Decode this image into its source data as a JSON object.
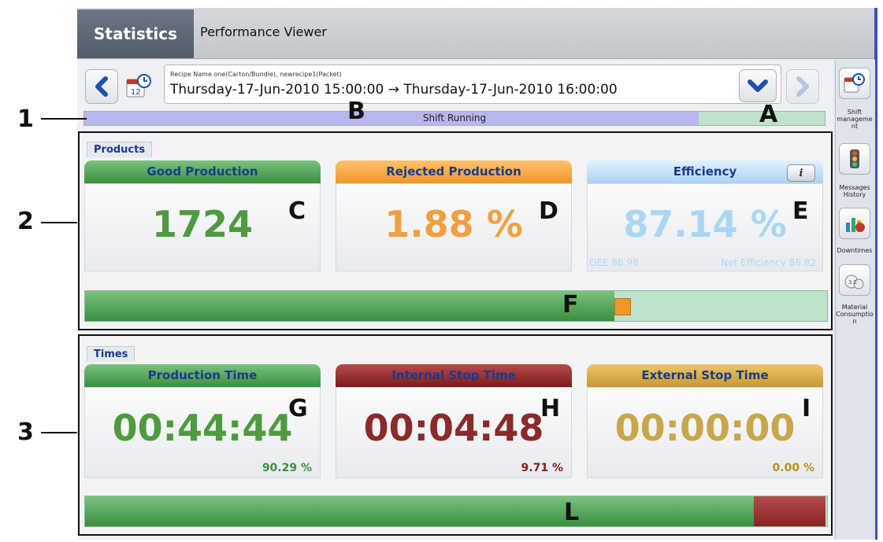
{
  "app": {
    "title": "Statistics",
    "subtitle": "Performance Viewer"
  },
  "nav": {
    "recipe": "Recipe Name   one(Carton/Bundle), newrecipe1(Packet)",
    "date_range": "Thursday-17-Jun-2010 15:00:00  →  Thursday-17-Jun-2010 16:00:00"
  },
  "shift": {
    "status": "Shift Running",
    "progress": 0.83
  },
  "products": {
    "label": "Products",
    "good": {
      "title": "Good Production",
      "value": "1724"
    },
    "rejected": {
      "title": "Rejected Production",
      "value": "1.88 %"
    },
    "efficiency": {
      "title": "Efficiency",
      "value": "87.14 %",
      "oee": "OEE 86.98",
      "net": "Net Efficiency 86.82"
    },
    "bar": {
      "good_fraction": 0.715,
      "rejected_fraction": 0.02
    }
  },
  "times": {
    "label": "Times",
    "production": {
      "title": "Production Time",
      "value": "00:44:44",
      "pct": "90.29 %"
    },
    "internal": {
      "title": "Internal Stop Time",
      "value": "00:04:48",
      "pct": "9.71 %"
    },
    "external": {
      "title": "External Stop Time",
      "value": "00:00:00",
      "pct": "0.00 %"
    },
    "bar": {
      "production_fraction": 0.9029,
      "internal_fraction": 0.0971
    }
  },
  "sidebar": [
    {
      "label": "Shift manageme nt",
      "icon": "calendar-clock-icon"
    },
    {
      "label": "Messages History",
      "icon": "traffic-light-icon"
    },
    {
      "label": "Downtimes",
      "icon": "bar-chart-stop-icon"
    },
    {
      "label": "Material Consumptio n",
      "icon": "material-dice-icon"
    }
  ],
  "annotations": {
    "callouts": [
      "1",
      "2",
      "3"
    ],
    "letters": [
      "A",
      "B",
      "C",
      "D",
      "E",
      "F",
      "G",
      "H",
      "I",
      "L"
    ]
  },
  "colors": {
    "green": "#3a8f3f",
    "orange": "#f0962a",
    "light_blue": "#a9d3f2",
    "dark_red": "#7a1c1c",
    "gold": "#c69a2e",
    "label_blue": "#1a3b8c"
  }
}
